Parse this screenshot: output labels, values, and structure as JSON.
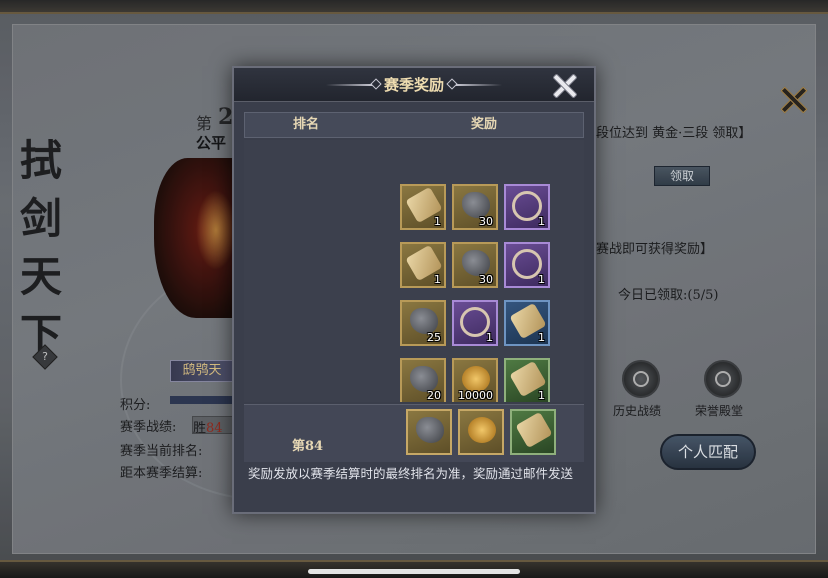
{
  "background": {
    "calligraphy_title": [
      "拭",
      "剑",
      "天",
      "下"
    ],
    "season_prefix": "第",
    "season_number": "2",
    "mode_name": "公平",
    "rank_banner": "鸱鸮天",
    "stats": {
      "score_label": "积分:",
      "record_label": "赛季战绩:",
      "record_win_label": "胜",
      "record_win_value": "84",
      "current_rank_label": "赛季当前排名:",
      "season_end_label": "距本赛季结算:"
    },
    "right_panel": {
      "rank_requirement_text": "段位达到 黄金·三段 领取】",
      "claim_button": "领取",
      "battle_reward_text": "赛战即可获得奖励】",
      "daily_claimed_text": "今日已领取:(5/5)",
      "history_label": "历史战绩",
      "honor_label": "荣誉殿堂",
      "match_button": "个人匹配"
    }
  },
  "modal": {
    "title": "赛季奖励",
    "columns": {
      "rank": "排名",
      "reward": "奖励"
    },
    "rows": [
      {
        "items": [
          {
            "type": "scroll",
            "rarity": "gold",
            "qty": "1"
          },
          {
            "type": "ore",
            "rarity": "gold",
            "qty": "30"
          },
          {
            "type": "ring",
            "rarity": "purple",
            "qty": "1"
          }
        ]
      },
      {
        "items": [
          {
            "type": "scroll",
            "rarity": "gold",
            "qty": "1"
          },
          {
            "type": "ore",
            "rarity": "gold",
            "qty": "30"
          },
          {
            "type": "ring",
            "rarity": "purple",
            "qty": "1"
          }
        ]
      },
      {
        "items": [
          {
            "type": "ore",
            "rarity": "gold",
            "qty": "25"
          },
          {
            "type": "ring",
            "rarity": "purple",
            "qty": "1"
          },
          {
            "type": "scroll",
            "rarity": "blue",
            "qty": "1"
          }
        ]
      },
      {
        "items": [
          {
            "type": "ore",
            "rarity": "gold",
            "qty": "20"
          },
          {
            "type": "coin",
            "rarity": "gold",
            "qty": "10000"
          },
          {
            "type": "scroll",
            "rarity": "green",
            "qty": "1"
          }
        ]
      }
    ],
    "my_rank": "第84",
    "my_rewards": [
      {
        "type": "ore",
        "rarity": "gold"
      },
      {
        "type": "coin",
        "rarity": "gold"
      },
      {
        "type": "scroll",
        "rarity": "green"
      }
    ],
    "note": "奖励发放以赛季结算时的最终排名为准，奖励通过邮件发送"
  }
}
